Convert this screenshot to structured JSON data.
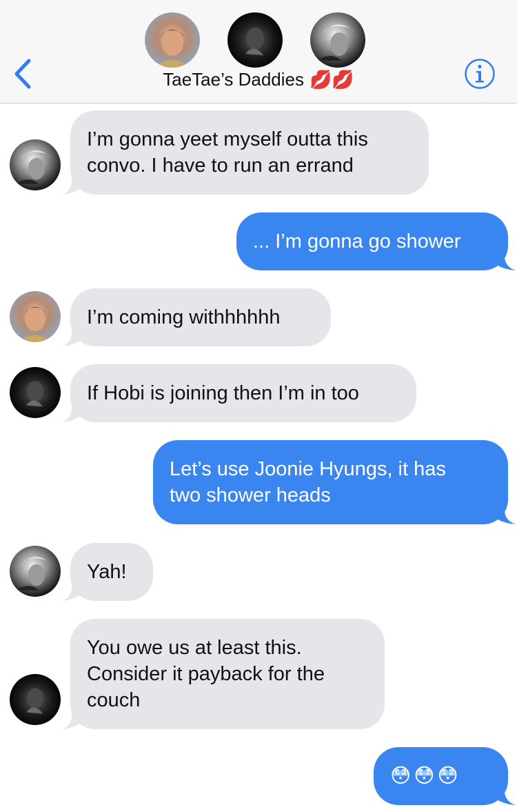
{
  "header": {
    "group_name": "TaeTae’s Daddies",
    "kiss_emojis": "💋💋",
    "avatars": [
      "hobi-avatar",
      "yoongi-avatar",
      "namjoon-avatar"
    ]
  },
  "messages": [
    {
      "sender": "namjoon",
      "direction": "incoming",
      "lines": [
        "I’m gonna yeet myself outta this",
        "convo. I have to run an errand"
      ]
    },
    {
      "sender": "me",
      "direction": "outgoing",
      "lines": [
        "... I’m gonna go shower"
      ]
    },
    {
      "sender": "hobi",
      "direction": "incoming",
      "lines": [
        "I’m coming withhhhhh"
      ]
    },
    {
      "sender": "yoongi",
      "direction": "incoming",
      "lines": [
        "If Hobi is joining then I’m in too"
      ]
    },
    {
      "sender": "me",
      "direction": "outgoing",
      "lines": [
        "Let’s use Joonie Hyungs, it has",
        "two shower heads"
      ]
    },
    {
      "sender": "namjoon",
      "direction": "incoming",
      "lines": [
        "Yah!"
      ]
    },
    {
      "sender": "yoongi",
      "direction": "incoming",
      "lines": [
        "You owe us at least this.",
        "Consider it payback for the",
        "couch"
      ]
    },
    {
      "sender": "me",
      "direction": "outgoing",
      "lines": [
        "😳😳😳"
      ]
    }
  ],
  "colors": {
    "incoming_bubble": "#e5e5ea",
    "outgoing_bubble": "#3a86f0",
    "accent": "#2f7cf6"
  }
}
